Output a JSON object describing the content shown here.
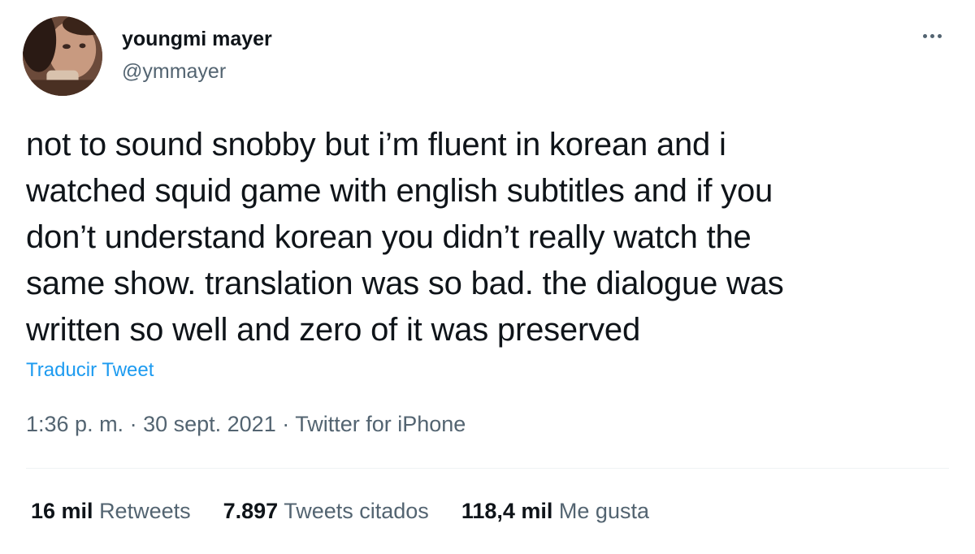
{
  "author": {
    "display_name": "youngmi mayer",
    "handle": "@ymmayer",
    "avatar": "profile-photo"
  },
  "more_icon": "ellipsis-icon",
  "tweet": {
    "lines": [
      "not to sound snobby but i’m fluent in korean and i",
      "watched squid game with english subtitles and if you",
      "don’t understand korean you didn’t really watch the",
      "same show. translation was so bad. the dialogue was",
      "written so well and zero of it was preserved"
    ],
    "translate_label": "Traducir Tweet"
  },
  "meta": {
    "time": "1:36 p. m.",
    "separator": " · ",
    "date": "30 sept. 2021",
    "source": "Twitter for iPhone"
  },
  "stats": [
    {
      "number": "16 mil",
      "label": "Retweets"
    },
    {
      "number": "7.897",
      "label": "Tweets citados"
    },
    {
      "number": "118,4 mil",
      "label": "Me gusta"
    }
  ],
  "colors": {
    "text": "#0f1419",
    "secondary": "#536471",
    "accent": "#1d9bf0",
    "divider": "#eff3f4"
  }
}
